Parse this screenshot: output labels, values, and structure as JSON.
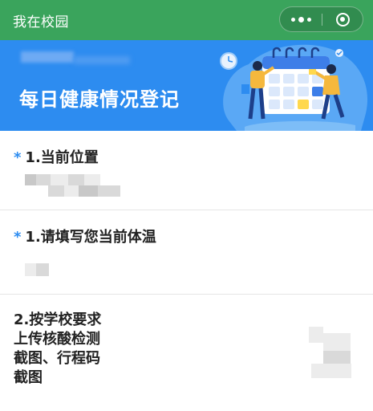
{
  "nav": {
    "title": "我在校园",
    "more_icon": "more-dots-icon",
    "close_icon": "target-close-icon"
  },
  "banner": {
    "title": "每日健康情况登记",
    "background": "#2d8cf0",
    "illustration": "calendar-people-illustration"
  },
  "form": {
    "q1": {
      "required": "*",
      "label": "1.当前位置"
    },
    "q2": {
      "required": "*",
      "label": "1.请填写您当前体温"
    },
    "q3": {
      "lines": [
        "2.按学校要求",
        "上传核酸检测",
        "截图、行程码",
        "截图"
      ]
    }
  },
  "colors": {
    "nav_green": "#3aa45c",
    "accent_blue": "#2d8cf0"
  }
}
